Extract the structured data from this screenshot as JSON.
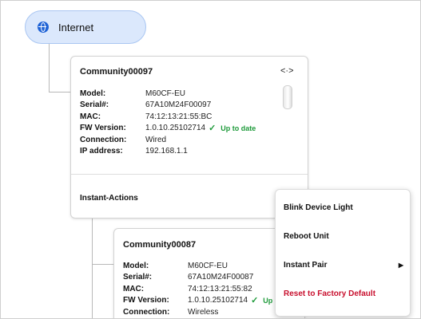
{
  "root": {
    "label": "Internet",
    "icon": "globe-icon"
  },
  "devices": [
    {
      "name": "Community00097",
      "expand_icon": "expand-arrows-icon",
      "fields": [
        {
          "label": "Model:",
          "value": "M60CF-EU"
        },
        {
          "label": "Serial#:",
          "value": "67A10M24F00097"
        },
        {
          "label": "MAC:",
          "value": "74:12:13:21:55:BC"
        },
        {
          "label": "FW Version:",
          "value": "1.0.10.25102714",
          "status": "Up to date"
        },
        {
          "label": "Connection:",
          "value": "Wired"
        },
        {
          "label": "IP address:",
          "value": "192.168.1.1"
        }
      ],
      "actions_label": "Instant-Actions"
    },
    {
      "name": "Community00087",
      "fields": [
        {
          "label": "Model:",
          "value": "M60CF-EU"
        },
        {
          "label": "Serial#:",
          "value": "67A10M24F00087"
        },
        {
          "label": "MAC:",
          "value": "74:12:13:21:55:82"
        },
        {
          "label": "FW Version:",
          "value": "1.0.10.25102714",
          "status": "Up"
        },
        {
          "label": "Connection:",
          "value": "Wireless"
        }
      ]
    }
  ],
  "menu": {
    "items": [
      {
        "label": "Blink Device Light"
      },
      {
        "label": "Reboot Unit"
      },
      {
        "label": "Instant Pair",
        "has_submenu": true
      },
      {
        "label": "Reset to Factory Default",
        "danger": true
      }
    ]
  },
  "colors": {
    "accent": "#1f63d6",
    "root_bg": "#dbe8fc",
    "success": "#1e9a3a",
    "danger": "#c8102e"
  }
}
